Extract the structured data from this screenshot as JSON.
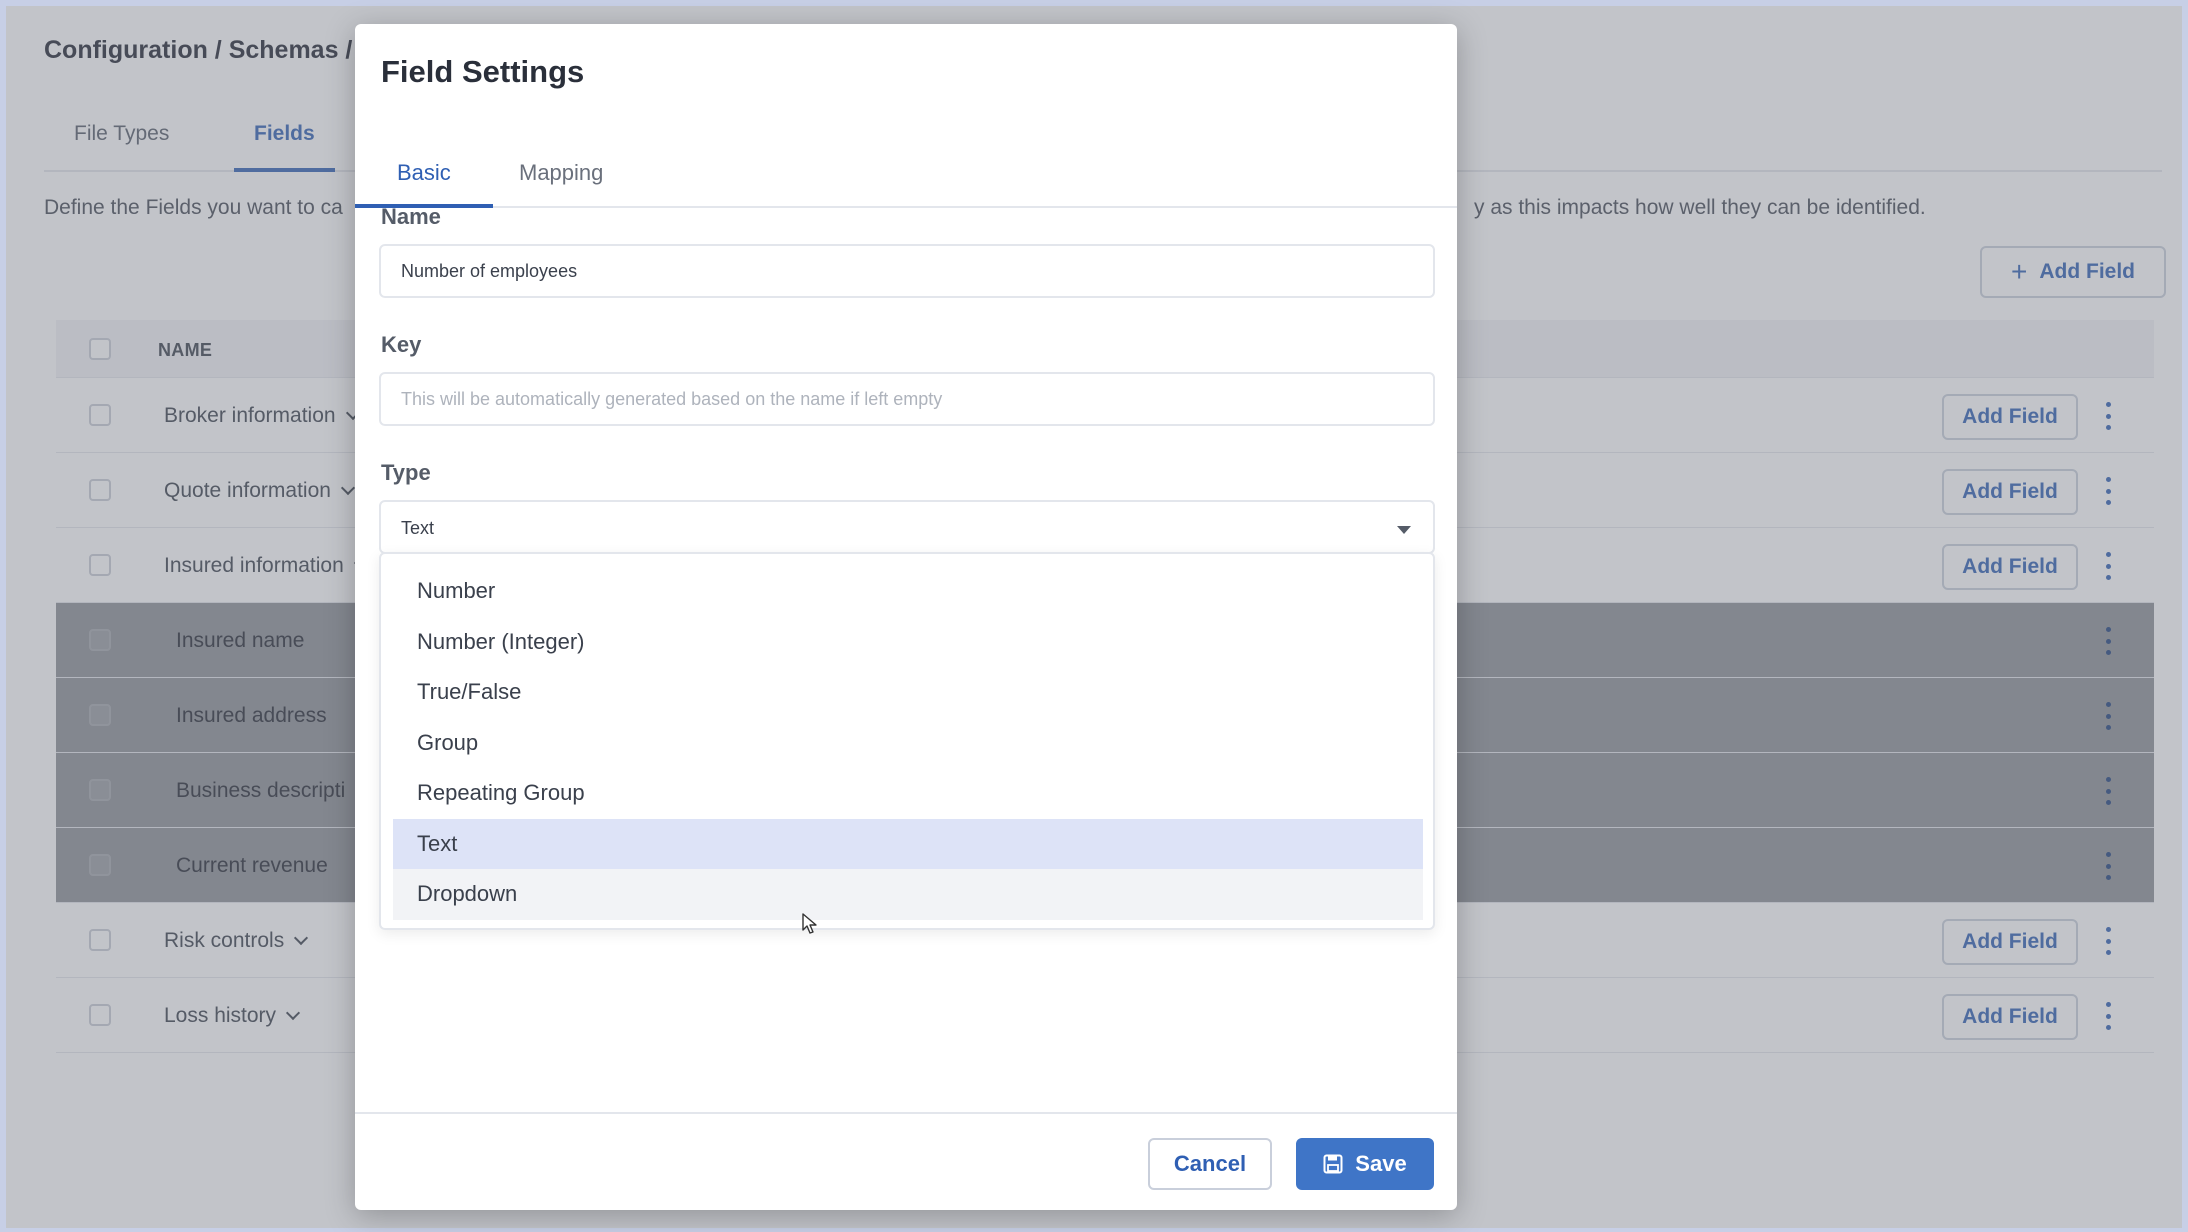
{
  "page": {
    "breadcrumb": "Configuration / Schemas /",
    "tabs": [
      {
        "label": "File Types",
        "active": false
      },
      {
        "label": "Fields",
        "active": true
      }
    ],
    "description_start": "Define the Fields you want to ca",
    "description_end": "y as this impacts how well they can be identified.",
    "add_field_label": "Add Field",
    "table": {
      "header_name": "NAME",
      "rows": [
        {
          "name": "Broker information",
          "child": false,
          "action": "Add Field"
        },
        {
          "name": "Quote information",
          "child": false,
          "action": "Add Field"
        },
        {
          "name": "Insured information",
          "child": false,
          "action": "Add Field"
        },
        {
          "name": "Insured name",
          "child": true,
          "action": ""
        },
        {
          "name": "Insured address",
          "child": true,
          "action": ""
        },
        {
          "name": "Business descripti",
          "child": true,
          "action": ""
        },
        {
          "name": "Current revenue",
          "child": true,
          "action": ""
        },
        {
          "name": "Risk controls",
          "child": false,
          "action": "Add Field"
        },
        {
          "name": "Loss history",
          "child": false,
          "action": "Add Field"
        }
      ]
    }
  },
  "modal": {
    "title": "Field Settings",
    "tabs": {
      "basic": "Basic",
      "mapping": "Mapping"
    },
    "name": {
      "label": "Name",
      "value": "Number of employees"
    },
    "key": {
      "label": "Key",
      "placeholder": "This will be automatically generated based on the name if left empty"
    },
    "type": {
      "label": "Type",
      "value": "Text",
      "options": [
        "Number",
        "Number (Integer)",
        "True/False",
        "Group",
        "Repeating Group",
        "Text",
        "Dropdown"
      ],
      "selected": "Text",
      "hovered": "Dropdown"
    },
    "cancel_label": "Cancel",
    "save_label": "Save"
  },
  "colors": {
    "accent": "#2f5fb3",
    "save": "#3f75c7",
    "selected_option": "#dde3f7"
  }
}
